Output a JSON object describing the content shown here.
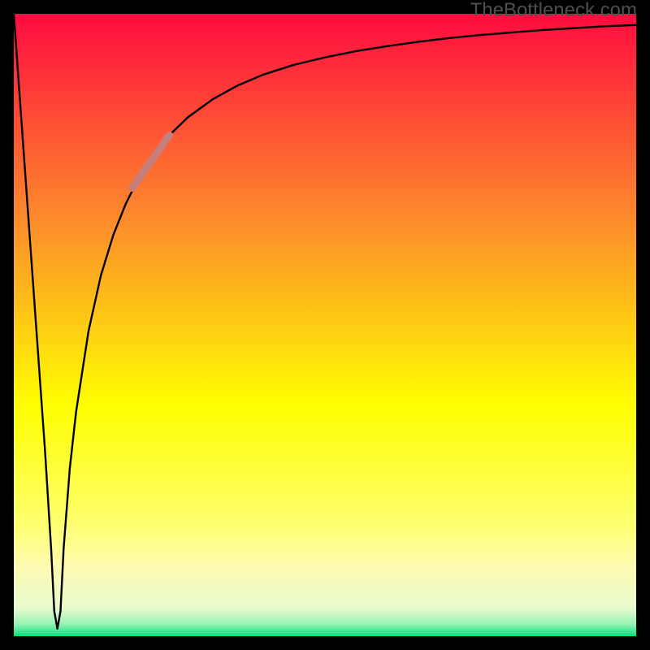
{
  "watermark": "TheBottleneck.com",
  "colors": {
    "frame": "#000000",
    "curve": "#000000",
    "highlight": "#c77f7e",
    "grad_top": "#fe0b3f",
    "grad_mid_upper": "#fd8f2b",
    "grad_mid": "#fefe00",
    "grad_low": "#fdfab2",
    "grad_near_bottom": "#e8fbce",
    "grad_bottom": "#00e47c"
  },
  "chart_data": {
    "type": "line",
    "title": "",
    "xlabel": "",
    "ylabel": "",
    "xlim": [
      0,
      100
    ],
    "ylim": [
      0,
      100
    ],
    "x": [
      0,
      1,
      2,
      3,
      4,
      5,
      6,
      6.5,
      7,
      7.5,
      8,
      9,
      10,
      12,
      14,
      16,
      18,
      20,
      22,
      25,
      28,
      32,
      36,
      40,
      45,
      50,
      55,
      60,
      65,
      70,
      75,
      80,
      85,
      90,
      95,
      100
    ],
    "y": [
      100,
      86,
      72,
      58,
      44,
      30,
      14,
      4,
      1.2,
      4,
      14,
      27,
      36,
      49,
      58,
      64.5,
      69.5,
      73.5,
      76.8,
      80.5,
      83.4,
      86.3,
      88.5,
      90.2,
      91.8,
      93.0,
      94.0,
      94.8,
      95.5,
      96.1,
      96.6,
      97.0,
      97.4,
      97.7,
      98.0,
      98.2
    ],
    "highlight_segment": {
      "x0": 19,
      "y0": 72,
      "x1": 25,
      "y1": 80.5
    }
  }
}
